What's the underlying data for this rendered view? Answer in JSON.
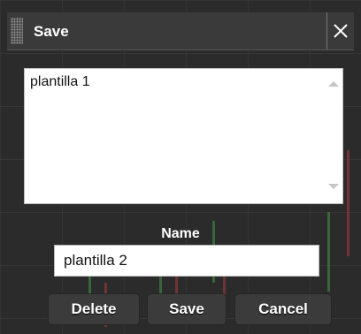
{
  "dialog": {
    "title": "Save",
    "list": {
      "items": [
        "plantilla 1"
      ]
    },
    "name_label": "Name",
    "name_input_value": "plantilla 2",
    "buttons": {
      "delete": "Delete",
      "save": "Save",
      "cancel": "Cancel"
    }
  },
  "icons": {
    "close": "close-icon",
    "grip": "grip-icon",
    "scroll_up": "arrow-up-icon",
    "scroll_down": "arrow-down-icon"
  },
  "colors": {
    "titlebar": "#3a3a3a",
    "button": "#3b3b3b",
    "chart_background": "#2b2b2b",
    "candle_up": "#469646",
    "candle_down": "#aa3c3c"
  }
}
